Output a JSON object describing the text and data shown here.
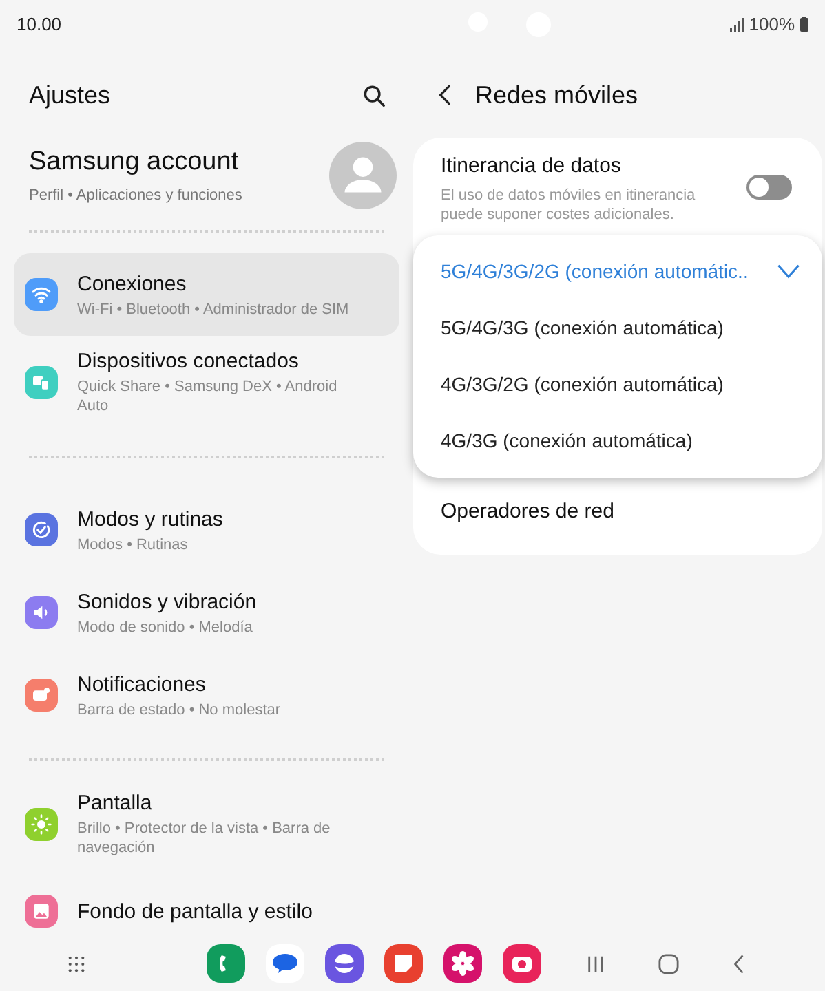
{
  "status_bar": {
    "time": "10.00",
    "battery": "100%"
  },
  "settings": {
    "title": "Ajustes",
    "account": {
      "name": "Samsung account",
      "subtitle": "Perfil • Aplicaciones y funciones"
    },
    "groups": [
      [
        {
          "kind": "wifi",
          "title": "Conexiones",
          "subtitle": "Wi-Fi • Bluetooth • Administrador de SIM",
          "selected": true
        },
        {
          "kind": "devices",
          "title": "Dispositivos conectados",
          "subtitle": "Quick Share • Samsung DeX • Android Auto",
          "selected": false
        }
      ],
      [
        {
          "kind": "routine",
          "title": "Modos y rutinas",
          "subtitle": "Modos • Rutinas",
          "selected": false
        },
        {
          "kind": "sound",
          "title": "Sonidos y vibración",
          "subtitle": "Modo de sonido • Melodía",
          "selected": false
        },
        {
          "kind": "notif",
          "title": "Notificaciones",
          "subtitle": "Barra de estado • No molestar",
          "selected": false
        }
      ],
      [
        {
          "kind": "display",
          "title": "Pantalla",
          "subtitle": "Brillo • Protector de la vista • Barra de navegación",
          "selected": false
        },
        {
          "kind": "wallpaper",
          "title": "Fondo de pantalla y estilo",
          "selected": false
        }
      ]
    ]
  },
  "detail": {
    "title": "Redes móviles",
    "roaming": {
      "title": "Itinerancia de datos",
      "description": "El uso de datos móviles en itinerancia puede suponer costes adicionales.",
      "on": false
    },
    "network_mode_options": [
      {
        "label": "5G/4G/3G/2G (conexión automátic..",
        "selected": true
      },
      {
        "label": "5G/4G/3G (conexión automática)",
        "selected": false
      },
      {
        "label": "4G/3G/2G (conexión automática)",
        "selected": false
      },
      {
        "label": "4G/3G (conexión automática)",
        "selected": false
      }
    ],
    "operators": "Operadores de red"
  }
}
